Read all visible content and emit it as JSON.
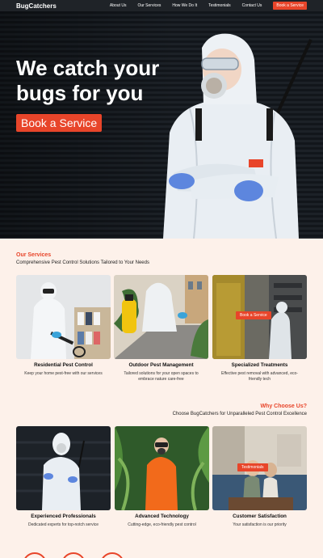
{
  "nav": {
    "logo": "BugCatchers",
    "links": [
      "About Us",
      "Our Services",
      "How We Do It",
      "Testimonials",
      "Contact Us"
    ],
    "cta": "Book a Service"
  },
  "hero": {
    "title": "We catch your bugs for you",
    "button": "Book a Service"
  },
  "services": {
    "title": "Our Services",
    "subtitle": "Comprehensive Pest Control Solutions Tailored to Your Needs",
    "cards": [
      {
        "title": "Residential Pest Control",
        "desc": "Keep your home pest-free with our services"
      },
      {
        "title": "Outdoor Pest Management",
        "desc": "Tailored solutions for your open spaces to embrace nature care-free"
      },
      {
        "title": "Specialized Treatments",
        "desc": "Effective pest removal with advanced, eco-friendly tech",
        "overlay": "Book a Service"
      }
    ]
  },
  "why": {
    "title": "Why Choose Us?",
    "subtitle": "Choose BugCatchers for Unparalleled Pest Control Excellence",
    "cards": [
      {
        "title": "Experienced Professionals",
        "desc": "Dedicated experts for top-notch service"
      },
      {
        "title": "Advanced Technology",
        "desc": "Cutting-edge, eco-friendly pest control"
      },
      {
        "title": "Customer Satisfaction",
        "desc": "Your satisfaction is our priority",
        "overlay": "Testimonials"
      }
    ]
  },
  "colors": {
    "accent": "#e8452a",
    "background": "#fdf1ea",
    "nav": "#1f2328"
  }
}
